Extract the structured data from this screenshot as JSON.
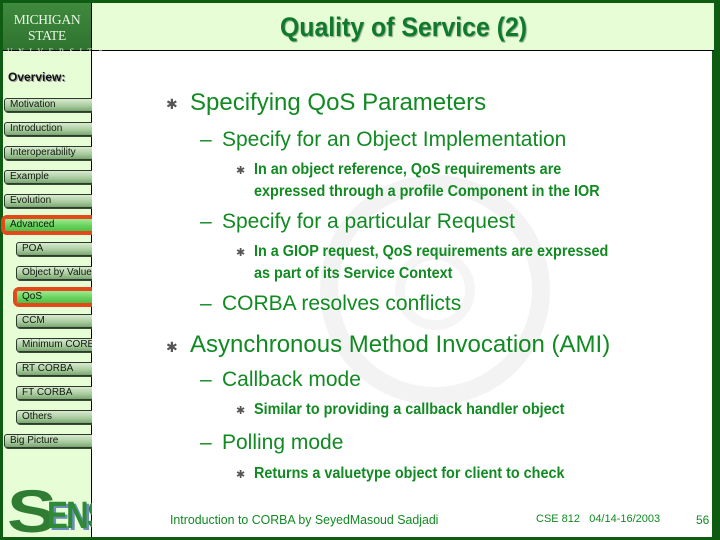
{
  "header": {
    "logo_line1": "MICHIGAN STATE",
    "logo_line2": "UNIVERSITY",
    "title": "Quality of Service (2)"
  },
  "sidebar": {
    "heading": "Overview:",
    "items": [
      {
        "label": "Motivation",
        "level": 1,
        "active": false
      },
      {
        "label": "Introduction",
        "level": 1,
        "active": false
      },
      {
        "label": "Interoperability",
        "level": 1,
        "active": false
      },
      {
        "label": "Example",
        "level": 1,
        "active": false
      },
      {
        "label": "Evolution",
        "level": 1,
        "active": false
      },
      {
        "label": "Advanced",
        "level": 1,
        "active": true
      },
      {
        "label": "POA",
        "level": 2,
        "active": false
      },
      {
        "label": "Object by Value",
        "level": 2,
        "active": false
      },
      {
        "label": "QoS",
        "level": 2,
        "active": true
      },
      {
        "label": "CCM",
        "level": 2,
        "active": false
      },
      {
        "label": "Minimum CORBA",
        "level": 2,
        "active": false
      },
      {
        "label": "RT CORBA",
        "level": 2,
        "active": false
      },
      {
        "label": "FT CORBA",
        "level": 2,
        "active": false
      },
      {
        "label": "Others",
        "level": 2,
        "active": false
      },
      {
        "label": "Big Picture",
        "level": 1,
        "active": false
      }
    ],
    "bottom_logo": {
      "big_letter": "S",
      "rest": "ENS"
    }
  },
  "content": {
    "bullets": [
      {
        "text": "Specifying QoS Parameters",
        "sub": [
          {
            "text": "Specify for an Object Implementation",
            "sub": [
              "In an object reference, QoS requirements are",
              "expressed through a profile Component in the IOR"
            ]
          },
          {
            "text": "Specify for a particular Request",
            "sub": [
              "In a GIOP request, QoS requirements are expressed",
              "as part of its Service Context"
            ]
          },
          {
            "text": "CORBA resolves conflicts",
            "sub": []
          }
        ]
      },
      {
        "text": "Asynchronous Method Invocation (AMI)",
        "sub": [
          {
            "text": "Callback mode",
            "sub": [
              "Similar to providing a callback handler object"
            ]
          },
          {
            "text": "Polling mode",
            "sub": [
              "Returns a valuetype object for client to check"
            ]
          }
        ]
      }
    ],
    "bullet_glyph": "✱",
    "dash_glyph": "–"
  },
  "footer": {
    "left": "Introduction to CORBA by SeyedMasoud Sadjadi",
    "course": "CSE 812   04/14-16/2003",
    "page": "56"
  },
  "colors": {
    "frame": "#0e5c12",
    "panel_bg": "#e6fdd5",
    "text_green": "#118a22",
    "title_green": "#107a2c",
    "active_outline": "#e2481a"
  }
}
